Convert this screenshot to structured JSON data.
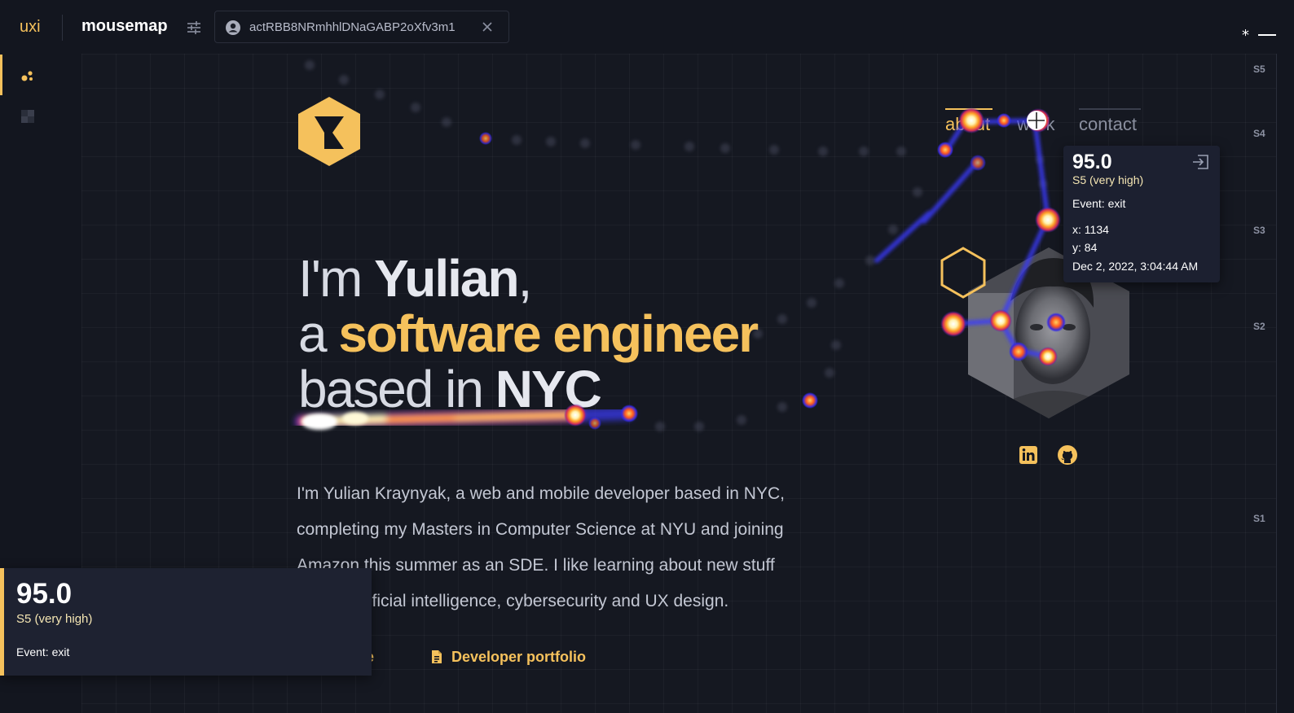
{
  "app": {
    "brand": "uxi",
    "title": "mousemap",
    "session_id": "actRBB8NRmhhlDNaGABP2oXfv3m1",
    "star": "*"
  },
  "sidebar": {
    "items": [
      {
        "icon": "heatmap-dots-icon",
        "active": true
      },
      {
        "icon": "grid-square-icon",
        "active": false
      }
    ]
  },
  "scale": {
    "labels": [
      "S5",
      "S4",
      "S3",
      "S2",
      "S1"
    ]
  },
  "site": {
    "nav": [
      "about",
      "work",
      "contact"
    ],
    "headline": {
      "l1_a": "I'm ",
      "l1_b": "Yulian",
      "l1_c": ",",
      "l2_a": "a ",
      "l2_b": "software engineer",
      "l3_a": "based in ",
      "l3_b": "NYC"
    },
    "bio_lines": [
      "I'm Yulian Kraynyak, a web and mobile developer based in NYC,",
      "completing my Masters in Computer Science at NYU and joining",
      "Amazon this summer as an SDE. I like learning about new stuff",
      "rtificial intelligence, cybersecurity and UX design."
    ],
    "resume_tail": "e",
    "portfolio_label": "Developer portfolio"
  },
  "tooltip": {
    "score": "95.0",
    "level": "S5 (very high)",
    "event": "Event: exit",
    "x": "x: 1134",
    "y": "y: 84",
    "timestamp": "Dec 2, 2022, 3:04:44 AM"
  },
  "bottom_card": {
    "score": "95.0",
    "level": "S5 (very high)",
    "event": "Event: exit"
  },
  "colors": {
    "accent": "#f5c15c",
    "background": "#13161f"
  }
}
